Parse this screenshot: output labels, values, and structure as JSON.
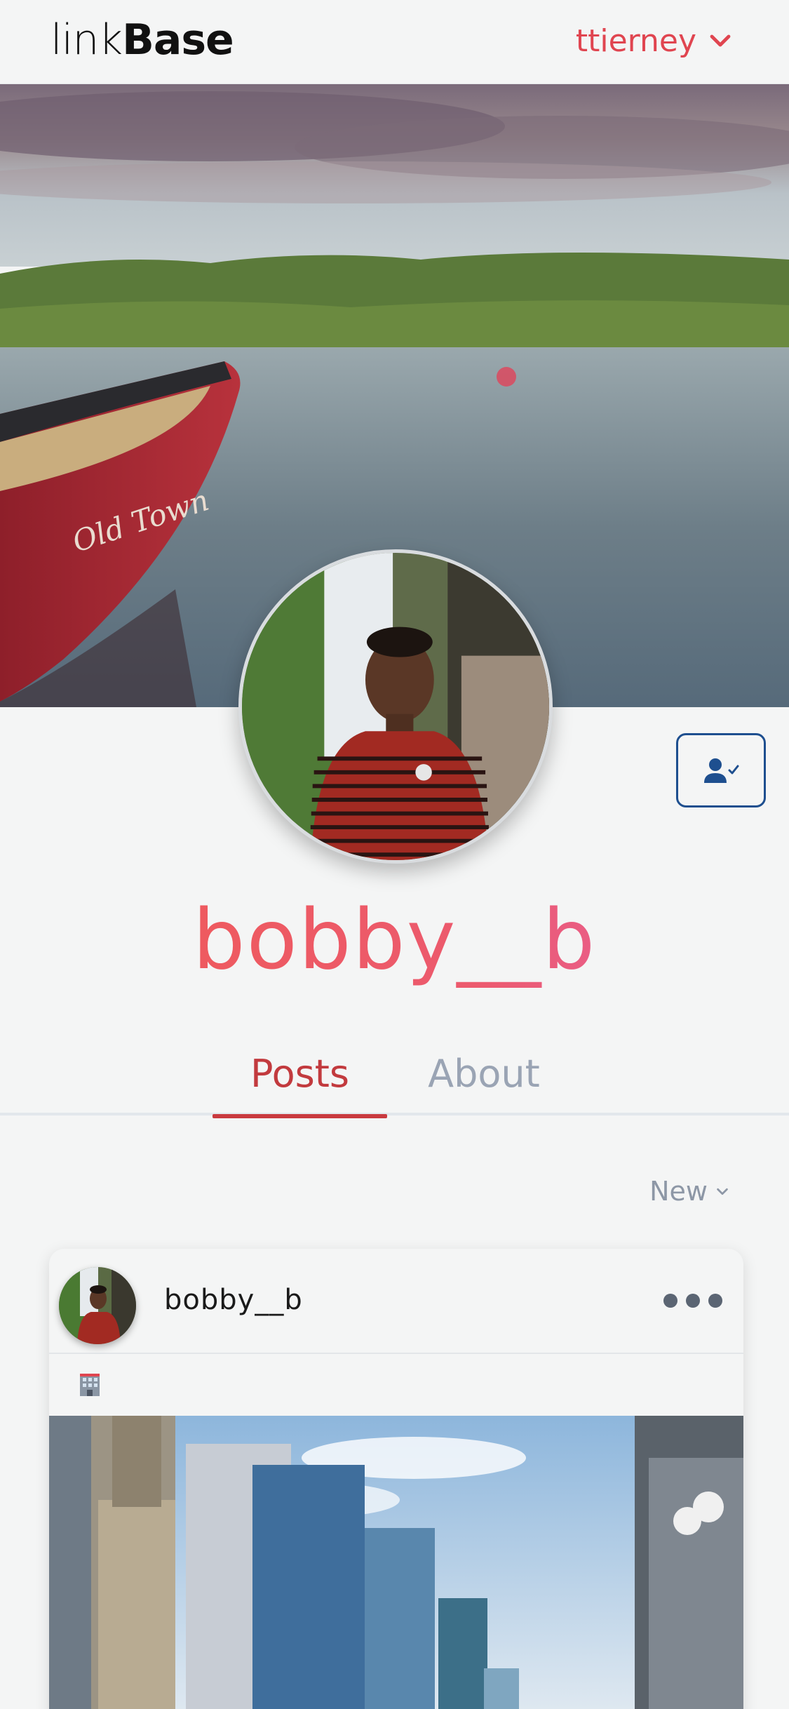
{
  "header": {
    "logo_light": "link",
    "logo_bold": "Base",
    "current_user": "ttierney",
    "user_menu_icon": "chevron-down-icon"
  },
  "profile": {
    "username": "bobby__b",
    "follow_button_icon": "user-check-icon"
  },
  "tabs": [
    {
      "label": "Posts",
      "active": true
    },
    {
      "label": "About",
      "active": false
    }
  ],
  "sort": {
    "label": "New",
    "icon": "chevron-down-icon"
  },
  "post": {
    "author": "bobby__b",
    "menu_icon": "more-horizontal-icon",
    "meta_icon": "office-building-icon"
  },
  "colors": {
    "accent": "#e04550",
    "name_gradient_start": "#ef5a55",
    "name_gradient_end": "#e563a8",
    "follow_border": "#1e4f8f",
    "inactive_tab": "#9aa4b4"
  }
}
